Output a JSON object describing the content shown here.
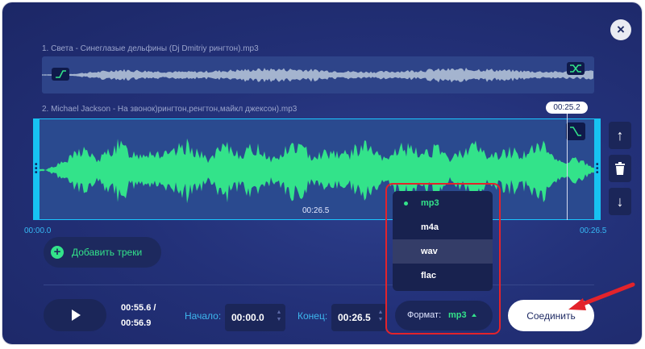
{
  "close_icon": "×",
  "track1": {
    "title": "1. Света - Синеглазые дельфины (Dj Dmitriy рингтон).mp3"
  },
  "track2": {
    "title": "2. Michael Jackson - На звонок)рингтон,ренгтон,майкл джексон).mp3"
  },
  "timeline": {
    "start": "00:00.0",
    "end": "00:26.5",
    "marker": "00:26.5",
    "playhead": "00:25.2"
  },
  "side_controls": {
    "up": "↑",
    "delete": "trash-icon",
    "down": "↓"
  },
  "add_tracks": {
    "label": "Добавить треки"
  },
  "playback": {
    "current": "00:55.6 /",
    "total": "00:56.9"
  },
  "start_field": {
    "label": "Начало:",
    "value": "00:00.0"
  },
  "end_field": {
    "label": "Конец:",
    "value": "00:26.5"
  },
  "format": {
    "label": "Формат:",
    "value": "mp3",
    "options": [
      "mp3",
      "m4a",
      "wav",
      "flac"
    ]
  },
  "join_button": {
    "label": "Соединить"
  },
  "colors": {
    "accent": "#33e38a",
    "cyan": "#17c3f2",
    "highlight": "#e3232b",
    "panel": "#233179"
  }
}
